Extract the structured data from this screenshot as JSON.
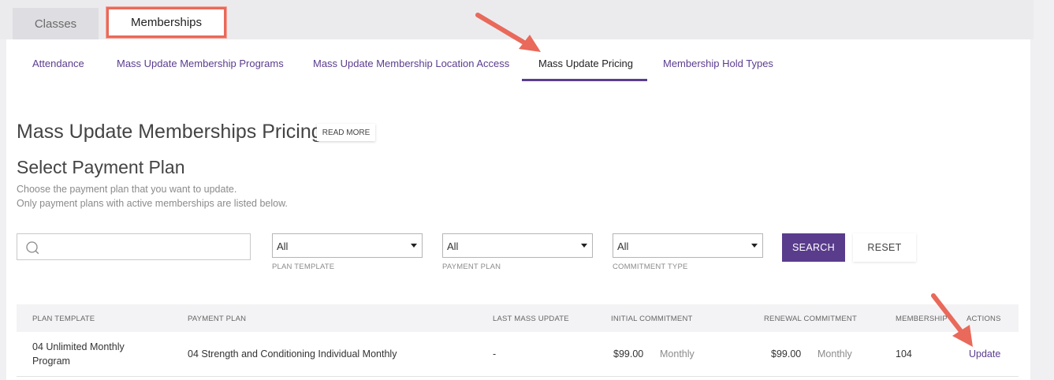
{
  "main_tabs": [
    {
      "label": "Classes"
    },
    {
      "label": "Memberships"
    }
  ],
  "sub_tabs": [
    {
      "label": "Attendance"
    },
    {
      "label": "Mass Update Membership Programs"
    },
    {
      "label": "Mass Update Membership Location Access"
    },
    {
      "label": "Mass Update Pricing",
      "active": true
    },
    {
      "label": "Membership Hold Types"
    }
  ],
  "page": {
    "title": "Mass Update Memberships Pricing",
    "read_more": "READ MORE",
    "subtitle": "Select Payment Plan",
    "desc_line1": "Choose the payment plan that you want to update.",
    "desc_line2": "Only payment plans with active memberships are listed below."
  },
  "filters": {
    "search_placeholder": "",
    "plan_template": {
      "value": "All",
      "label": "PLAN TEMPLATE"
    },
    "payment_plan": {
      "value": "All",
      "label": "PAYMENT PLAN"
    },
    "commitment_type": {
      "value": "All",
      "label": "COMMITMENT TYPE"
    },
    "search_button": "SEARCH",
    "reset_button": "RESET"
  },
  "table": {
    "headers": [
      "PLAN TEMPLATE",
      "PAYMENT PLAN",
      "LAST MASS UPDATE",
      "INITIAL COMMITMENT",
      "RENEWAL COMMITMENT",
      "MEMBERSHIPS",
      "ACTIONS"
    ],
    "rows": [
      {
        "plan_template_line1": "04 Unlimited Monthly",
        "plan_template_line2": "Program",
        "payment_plan": "04 Strength and Conditioning Individual Monthly",
        "last_mass_update": "-",
        "initial_amount": "$99.00",
        "initial_period": "Monthly",
        "renewal_amount": "$99.00",
        "renewal_period": "Monthly",
        "memberships": "104",
        "action": "Update"
      }
    ]
  },
  "colors": {
    "accent": "#5a3c8c",
    "highlight": "#e9695a"
  }
}
